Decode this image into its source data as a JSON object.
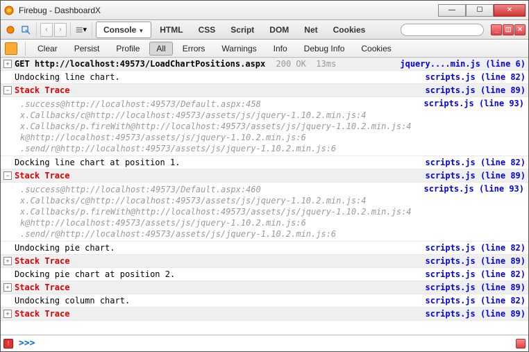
{
  "window": {
    "title": "Firebug - DashboardX"
  },
  "panels": [
    "Console",
    "HTML",
    "CSS",
    "Script",
    "DOM",
    "Net",
    "Cookies"
  ],
  "subtoolbar": [
    "Clear",
    "Persist",
    "Profile",
    "All",
    "Errors",
    "Warnings",
    "Info",
    "Debug Info",
    "Cookies"
  ],
  "active_panel": "Console",
  "active_filter": "All",
  "search": {
    "placeholder": ""
  },
  "prompt": ">>>",
  "sources": {
    "jq": "jquery....min.js (line 6)",
    "s82": "scripts.js (line 82)",
    "s89": "scripts.js (line 89)",
    "s93": "scripts.js (line 93)"
  },
  "request": {
    "method": "GET",
    "url": "http://localhost:49573/LoadChartPositions.aspx",
    "status": "200 OK",
    "time": "13ms"
  },
  "stack_label": "Stack Trace",
  "logs": [
    "Undocking line chart.",
    "Docking line chart at position 1.",
    "Undocking pie chart.",
    "Docking pie chart at position 2.",
    "Undocking column chart."
  ],
  "trace458": [
    ".success@http://localhost:49573/Default.aspx:458",
    "x.Callbacks/c@http://localhost:49573/assets/js/jquery-1.10.2.min.js:4",
    "x.Callbacks/p.fireWith@http://localhost:49573/assets/js/jquery-1.10.2.min.js:4",
    "k@http://localhost:49573/assets/js/jquery-1.10.2.min.js:6",
    ".send/r@http://localhost:49573/assets/js/jquery-1.10.2.min.js:6"
  ],
  "trace460": [
    ".success@http://localhost:49573/Default.aspx:460",
    "x.Callbacks/c@http://localhost:49573/assets/js/jquery-1.10.2.min.js:4",
    "x.Callbacks/p.fireWith@http://localhost:49573/assets/js/jquery-1.10.2.min.js:4",
    "k@http://localhost:49573/assets/js/jquery-1.10.2.min.js:6",
    ".send/r@http://localhost:49573/assets/js/jquery-1.10.2.min.js:6"
  ]
}
